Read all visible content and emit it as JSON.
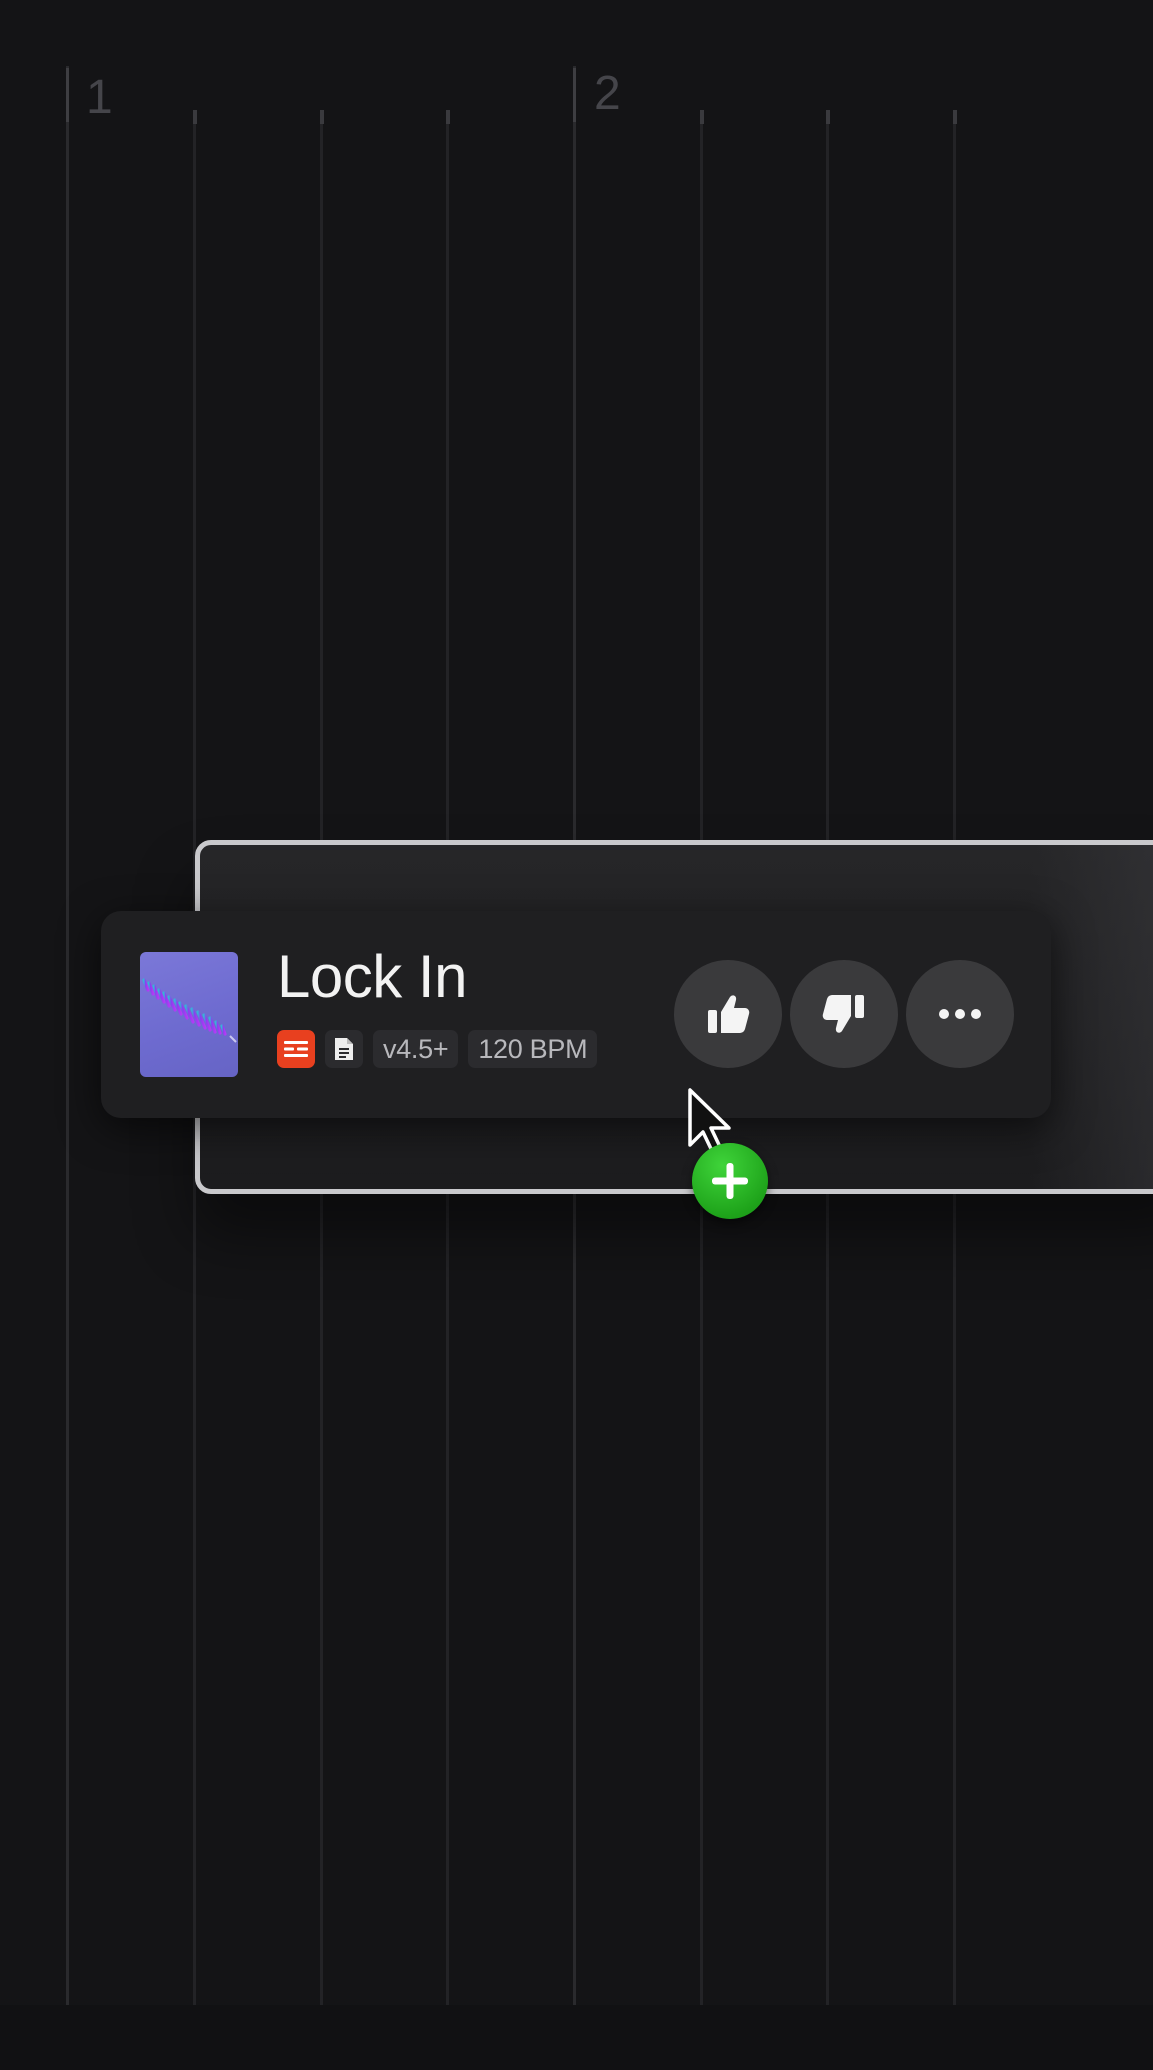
{
  "timeline": {
    "bars": [
      {
        "number": "1"
      },
      {
        "number": "2"
      }
    ]
  },
  "song": {
    "title": "Lock In",
    "version": "v4.5+",
    "tempo": "120 BPM",
    "cover_art": "purple-helix-cover",
    "icons": [
      "lyrics-icon",
      "document-icon"
    ]
  },
  "actions": {
    "like": "thumbs-up-icon",
    "dislike": "thumbs-down-icon",
    "more": "more-options-icon"
  },
  "drag": {
    "cursor": "arrow-cursor",
    "badge": "plus-icon"
  },
  "colors": {
    "background": "#141416",
    "card": "#1f1f21",
    "lyrics_badge": "#e8401f",
    "add_badge": "#1fa41b",
    "frame_border": "#c9c9cc"
  }
}
